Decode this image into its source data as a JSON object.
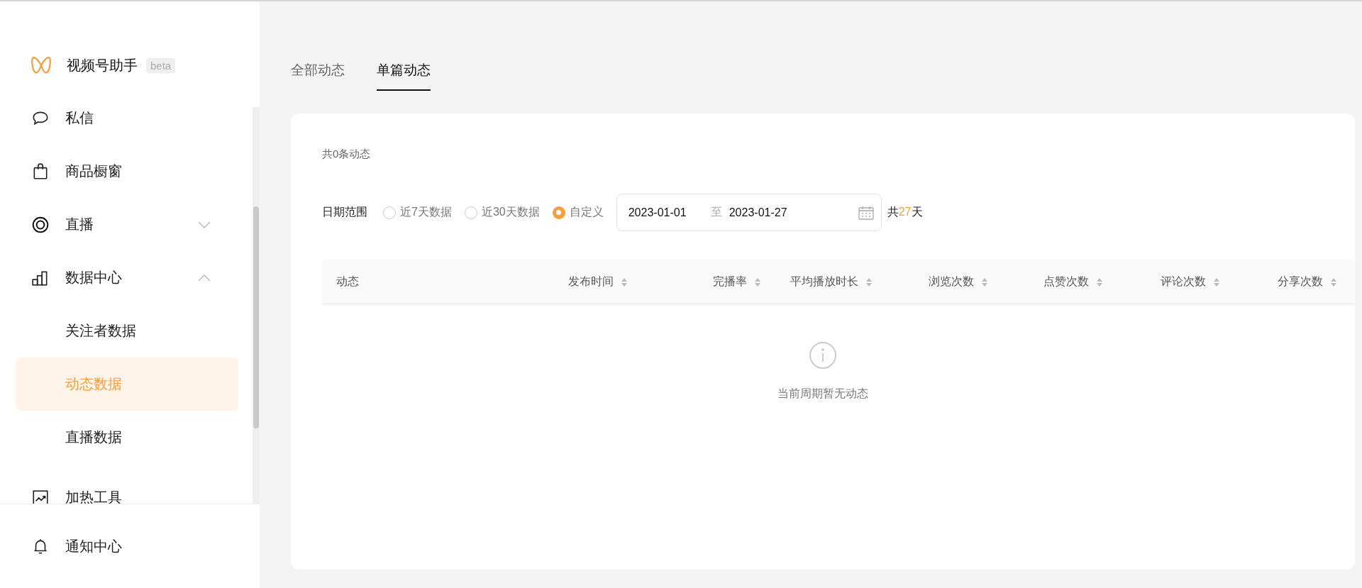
{
  "sidebar": {
    "app_name": "视频号助手",
    "badge": "beta",
    "items": [
      {
        "label": "私信",
        "selected": false
      },
      {
        "label": "商品橱窗",
        "selected": false
      },
      {
        "label": "直播",
        "selected": false,
        "expanded": false
      },
      {
        "label": "数据中心",
        "selected": false,
        "expanded": true,
        "children": [
          {
            "label": "关注者数据",
            "selected": false
          },
          {
            "label": "动态数据",
            "selected": true
          },
          {
            "label": "直播数据",
            "selected": false
          }
        ]
      },
      {
        "label": "加热工具",
        "selected": false
      }
    ],
    "footer_item": {
      "label": "通知中心"
    }
  },
  "tabs": [
    {
      "label": "全部动态",
      "selected": false
    },
    {
      "label": "单篇动态",
      "selected": true
    }
  ],
  "card": {
    "count_text": "共0条动态",
    "date_range": {
      "label": "日期范围",
      "options": [
        {
          "label": "近7天数据",
          "selected": false
        },
        {
          "label": "近30天数据",
          "selected": false
        },
        {
          "label": "自定义",
          "selected": true
        }
      ],
      "start": "2023-01-01",
      "separator": "至",
      "end": "2023-01-27",
      "total_prefix": "共",
      "total_days": "27",
      "total_suffix": "天"
    },
    "table": {
      "columns": [
        "动态",
        "发布时间",
        "完播率",
        "平均播放时长",
        "浏览次数",
        "点赞次数",
        "评论次数",
        "分享次数"
      ],
      "empty_text": "当前周期暂无动态"
    }
  }
}
